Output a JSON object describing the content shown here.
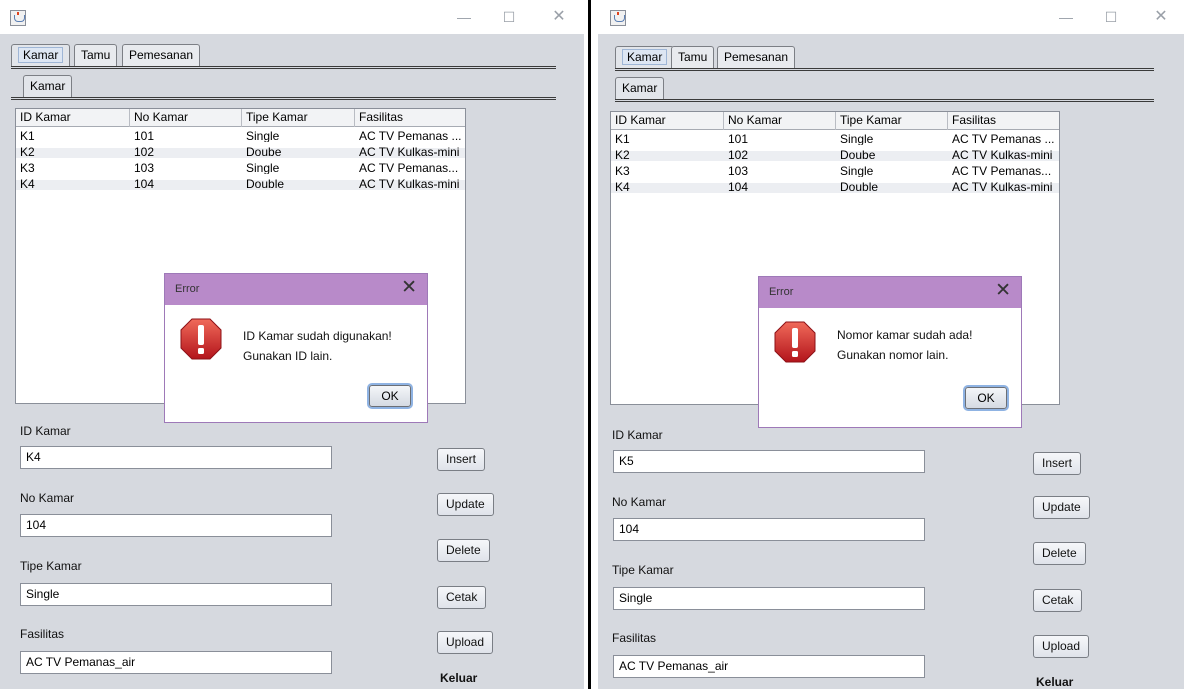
{
  "windows": [
    {
      "tabs": [
        "Kamar",
        "Tamu",
        "Pemesanan"
      ],
      "subtab": "Kamar",
      "table": {
        "headers": [
          "ID Kamar",
          "No Kamar",
          "Tipe Kamar",
          "Fasilitas"
        ],
        "rows": [
          [
            "K1",
            "101",
            "Single",
            "AC TV Pemanas ..."
          ],
          [
            "K2",
            "102",
            "Doube",
            "AC TV Kulkas-mini"
          ],
          [
            "K3",
            "103",
            "Single",
            "AC TV Pemanas..."
          ],
          [
            "K4",
            "104",
            "Double",
            "AC TV Kulkas-mini"
          ]
        ]
      },
      "dialog": {
        "title": "Error",
        "message_line1": "ID Kamar sudah digunakan!",
        "message_line2": "Gunakan ID lain.",
        "ok_label": "OK"
      },
      "form": {
        "id_label": "ID Kamar",
        "id_value": "K4",
        "no_label": "No Kamar",
        "no_value": "104",
        "tipe_label": "Tipe Kamar",
        "tipe_value": "Single",
        "fasilitas_label": "Fasilitas",
        "fasilitas_value": "AC TV Pemanas_air"
      },
      "buttons": {
        "insert": "Insert",
        "update": "Update",
        "delete": "Delete",
        "cetak": "Cetak",
        "upload": "Upload",
        "keluar": "Keluar"
      }
    },
    {
      "tabs": [
        "Kamar",
        "Tamu",
        "Pemesanan"
      ],
      "subtab": "Kamar",
      "table": {
        "headers": [
          "ID Kamar",
          "No Kamar",
          "Tipe Kamar",
          "Fasilitas"
        ],
        "rows": [
          [
            "K1",
            "101",
            "Single",
            "AC TV Pemanas ..."
          ],
          [
            "K2",
            "102",
            "Doube",
            "AC TV Kulkas-mini"
          ],
          [
            "K3",
            "103",
            "Single",
            "AC TV Pemanas..."
          ],
          [
            "K4",
            "104",
            "Double",
            "AC TV Kulkas-mini"
          ]
        ]
      },
      "dialog": {
        "title": "Error",
        "message_line1": "Nomor kamar sudah ada!",
        "message_line2": "Gunakan nomor lain.",
        "ok_label": "OK"
      },
      "form": {
        "id_label": "ID Kamar",
        "id_value": "K5",
        "no_label": "No Kamar",
        "no_value": "104",
        "tipe_label": "Tipe Kamar",
        "tipe_value": "Single",
        "fasilitas_label": "Fasilitas",
        "fasilitas_value": "AC TV Pemanas_air"
      },
      "buttons": {
        "insert": "Insert",
        "update": "Update",
        "delete": "Delete",
        "cetak": "Cetak",
        "upload": "Upload",
        "keluar": "Keluar"
      }
    }
  ],
  "icons": {
    "window": "java-cup-icon",
    "dialog": "error-stop-icon"
  },
  "colors": {
    "dialog_titlebar": "#b88ac9",
    "window_bg": "#d6d9df",
    "error_red": "#d0201f"
  }
}
